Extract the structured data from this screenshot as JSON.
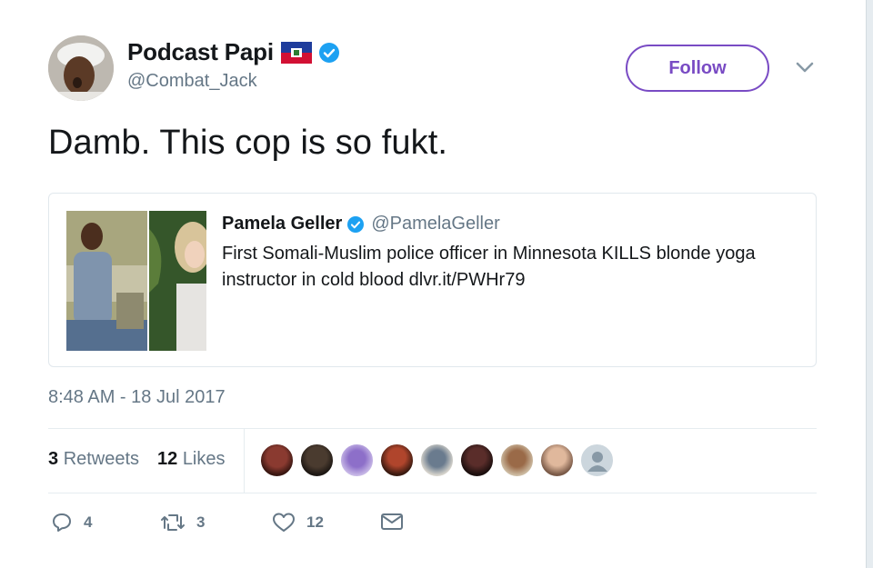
{
  "user": {
    "name": "Podcast Papi",
    "handle": "@Combat_Jack",
    "flag_icon": "haiti-flag-icon",
    "verified_icon": "verified-badge-icon"
  },
  "follow": {
    "label": "Follow",
    "accent": "#794bc4"
  },
  "tweet": {
    "text": "Damb. This cop is so fukt."
  },
  "quote": {
    "name": "Pamela Geller",
    "handle": "@PamelaGeller",
    "text": "First Somali-Muslim police officer in Minnesota KILLS blonde yoga instructor in cold blood dlvr.it/PWHr79"
  },
  "timestamp": "8:48 AM - 18 Jul 2017",
  "stats": {
    "retweets_count": "3",
    "retweets_label": "Retweets",
    "likes_count": "12",
    "likes_label": "Likes"
  },
  "likers_avatar_count": 9,
  "actions": {
    "reply_count": "4",
    "retweet_count": "3",
    "like_count": "12"
  },
  "colors": {
    "verified": "#1da1f2",
    "muted": "#657786",
    "text": "#14171a"
  }
}
